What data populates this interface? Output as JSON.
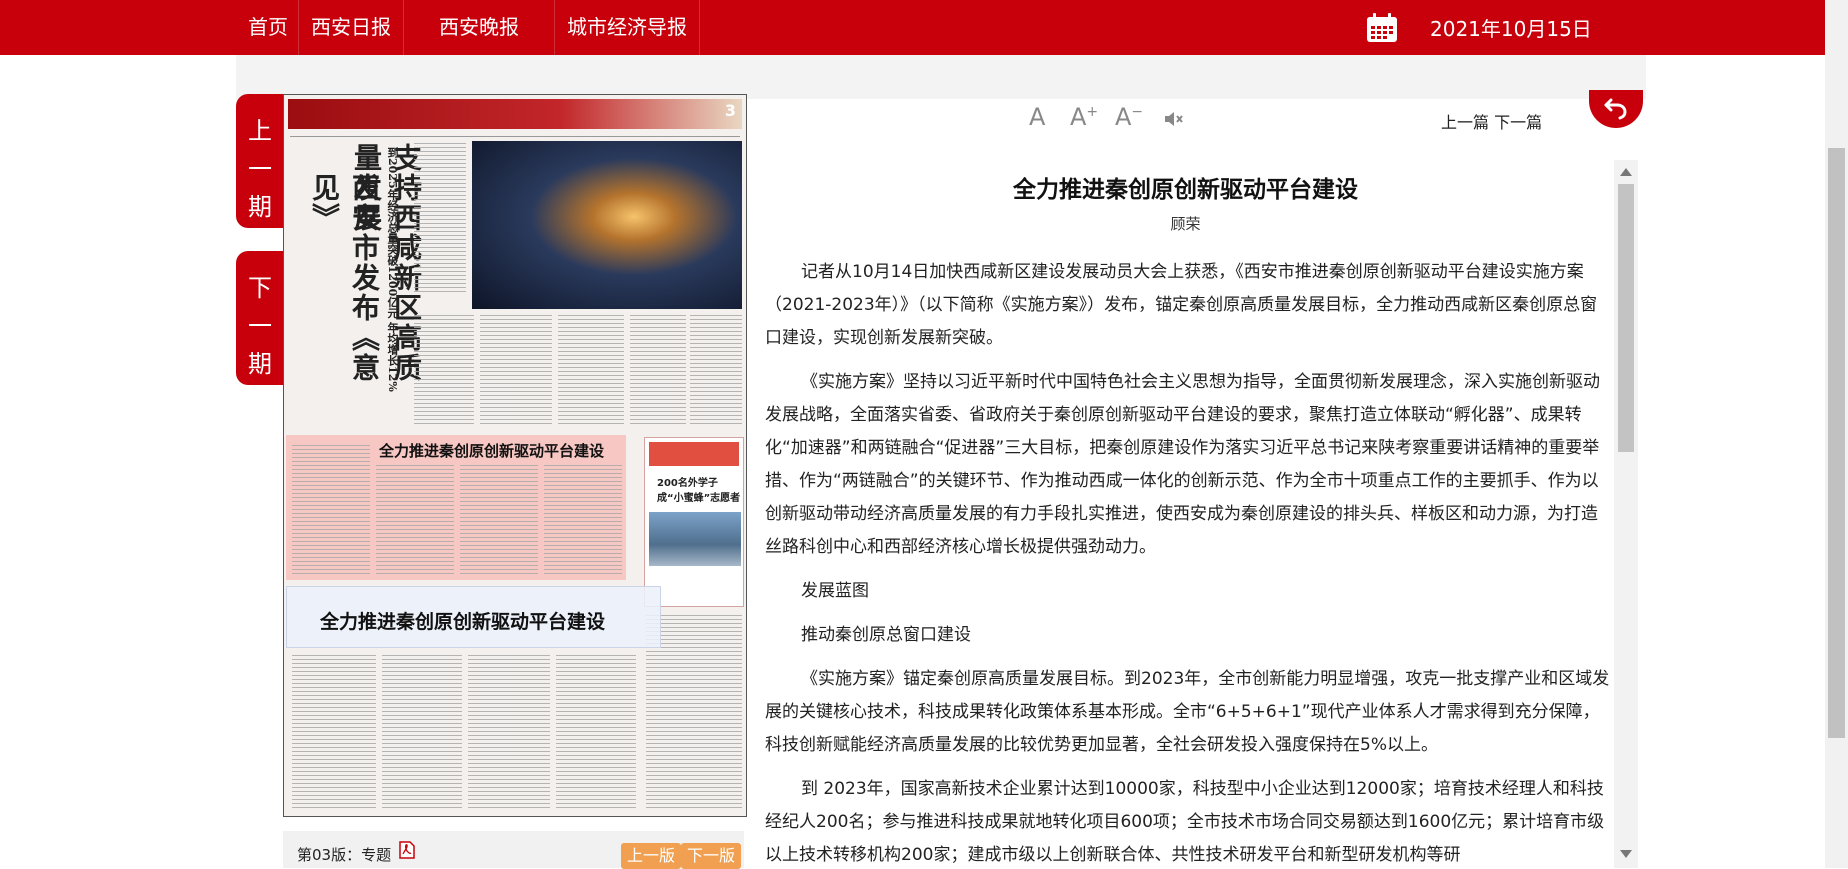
{
  "nav": {
    "items": [
      {
        "label": "首页"
      },
      {
        "label": "西安日报"
      },
      {
        "label": "西安晚报"
      },
      {
        "label": "城市经济导报"
      }
    ],
    "date": "2021年10月15日"
  },
  "side": {
    "prev_issue": "上一期",
    "next_issue": "下一期"
  },
  "page_image": {
    "badge": "3",
    "headline_main_1": "支持西咸新区高质量发展",
    "headline_main_2": "西安市发布《意见》",
    "headline_sub": "到2025年经济总量突破1200亿元 年均增长12%",
    "red_article_title": "全力推进秦创原创新驱动平台建设",
    "right_box_title": "200名外学子成“小蜜蜂”志愿者",
    "hover_title": "全力推进秦创原创新驱动平台建设"
  },
  "page_bar": {
    "label": "第03版：专题",
    "prev_page": "上一版",
    "next_page": "下一版"
  },
  "toolbar": {
    "font_normal": "A",
    "font_larger": "A",
    "font_smaller": "A",
    "plus": "+",
    "minus": "−",
    "prev_article": "上一篇",
    "next_article": "下一篇"
  },
  "article": {
    "title": "全力推进秦创原创新驱动平台建设",
    "author": "顾荣",
    "p1": "记者从10月14日加快西咸新区建设发展动员大会上获悉，《西安市推进秦创原创新驱动平台建设实施方案（2021-2023年）》（以下简称《实施方案》）发布，锚定秦创原高质量发展目标，全力推动西咸新区秦创原总窗口建设，实现创新发展新突破。",
    "p2": "《实施方案》坚持以习近平新时代中国特色社会主义思想为指导，全面贯彻新发展理念，深入实施创新驱动发展战略，全面落实省委、省政府关于秦创原创新驱动平台建设的要求，聚焦打造立体联动“孵化器”、成果转化“加速器”和两链融合“促进器”三大目标，把秦创原建设作为落实习近平总书记来陕考察重要讲话精神的重要举措、作为“两链融合”的关键环节、作为推动西咸一体化的创新示范、作为全市十项重点工作的主要抓手、作为以创新驱动带动经济高质量发展的有力手段扎实推进，使西安成为秦创原建设的排头兵、样板区和动力源，为打造丝路科创中心和西部经济核心增长极提供强劲动力。",
    "h1": "发展蓝图",
    "h2": "推动秦创原总窗口建设",
    "p3": "《实施方案》锚定秦创原高质量发展目标。到2023年，全市创新能力明显增强，攻克一批支撑产业和区域发展的关键核心技术，科技成果转化政策体系基本形成。全市“6+5+6+1”现代产业体系人才需求得到充分保障，科技创新赋能经济高质量发展的比较优势更加显著，全社会研发投入强度保持在5%以上。",
    "p4": "到 2023年，国家高新技术企业累计达到10000家，科技型中小企业达到12000家；培育技术经理人和科技经纪人200名；参与推进科技成果就地转化项目600项；全市技术市场合同交易额达到1600亿元；累计培育市级以上技术转移机构200家；建成市级以上创新联合体、共性技术研发平台和新型研发机构等研"
  },
  "colors": {
    "brand_red": "#c8000b",
    "button_orange": "#f0a050"
  }
}
